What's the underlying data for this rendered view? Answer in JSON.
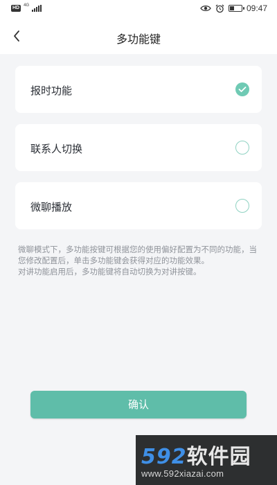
{
  "status_bar": {
    "hd": "HD",
    "network": "4G",
    "time": "09:47"
  },
  "nav": {
    "title": "多功能键",
    "back_icon": "chevron-left-icon"
  },
  "options": [
    {
      "label": "报时功能",
      "selected": true
    },
    {
      "label": "联系人切换",
      "selected": false
    },
    {
      "label": "微聊播放",
      "selected": false
    }
  ],
  "hint": {
    "line1": "微聊模式下，多功能按键可根据您的使用偏好配置为不同的功能，当您修改配置后，单击多功能键会获得对应的功能效果。",
    "line2": "对讲功能启用后，多功能键将自动切换为对讲按键。"
  },
  "confirm_label": "确认",
  "watermark": {
    "logo_num": "592",
    "logo_text": "软件园",
    "url": "www.592xiazai.com"
  },
  "colors": {
    "accent": "#5fbda9",
    "selected_check": "#6fcab4",
    "background": "#f4f5f7"
  }
}
